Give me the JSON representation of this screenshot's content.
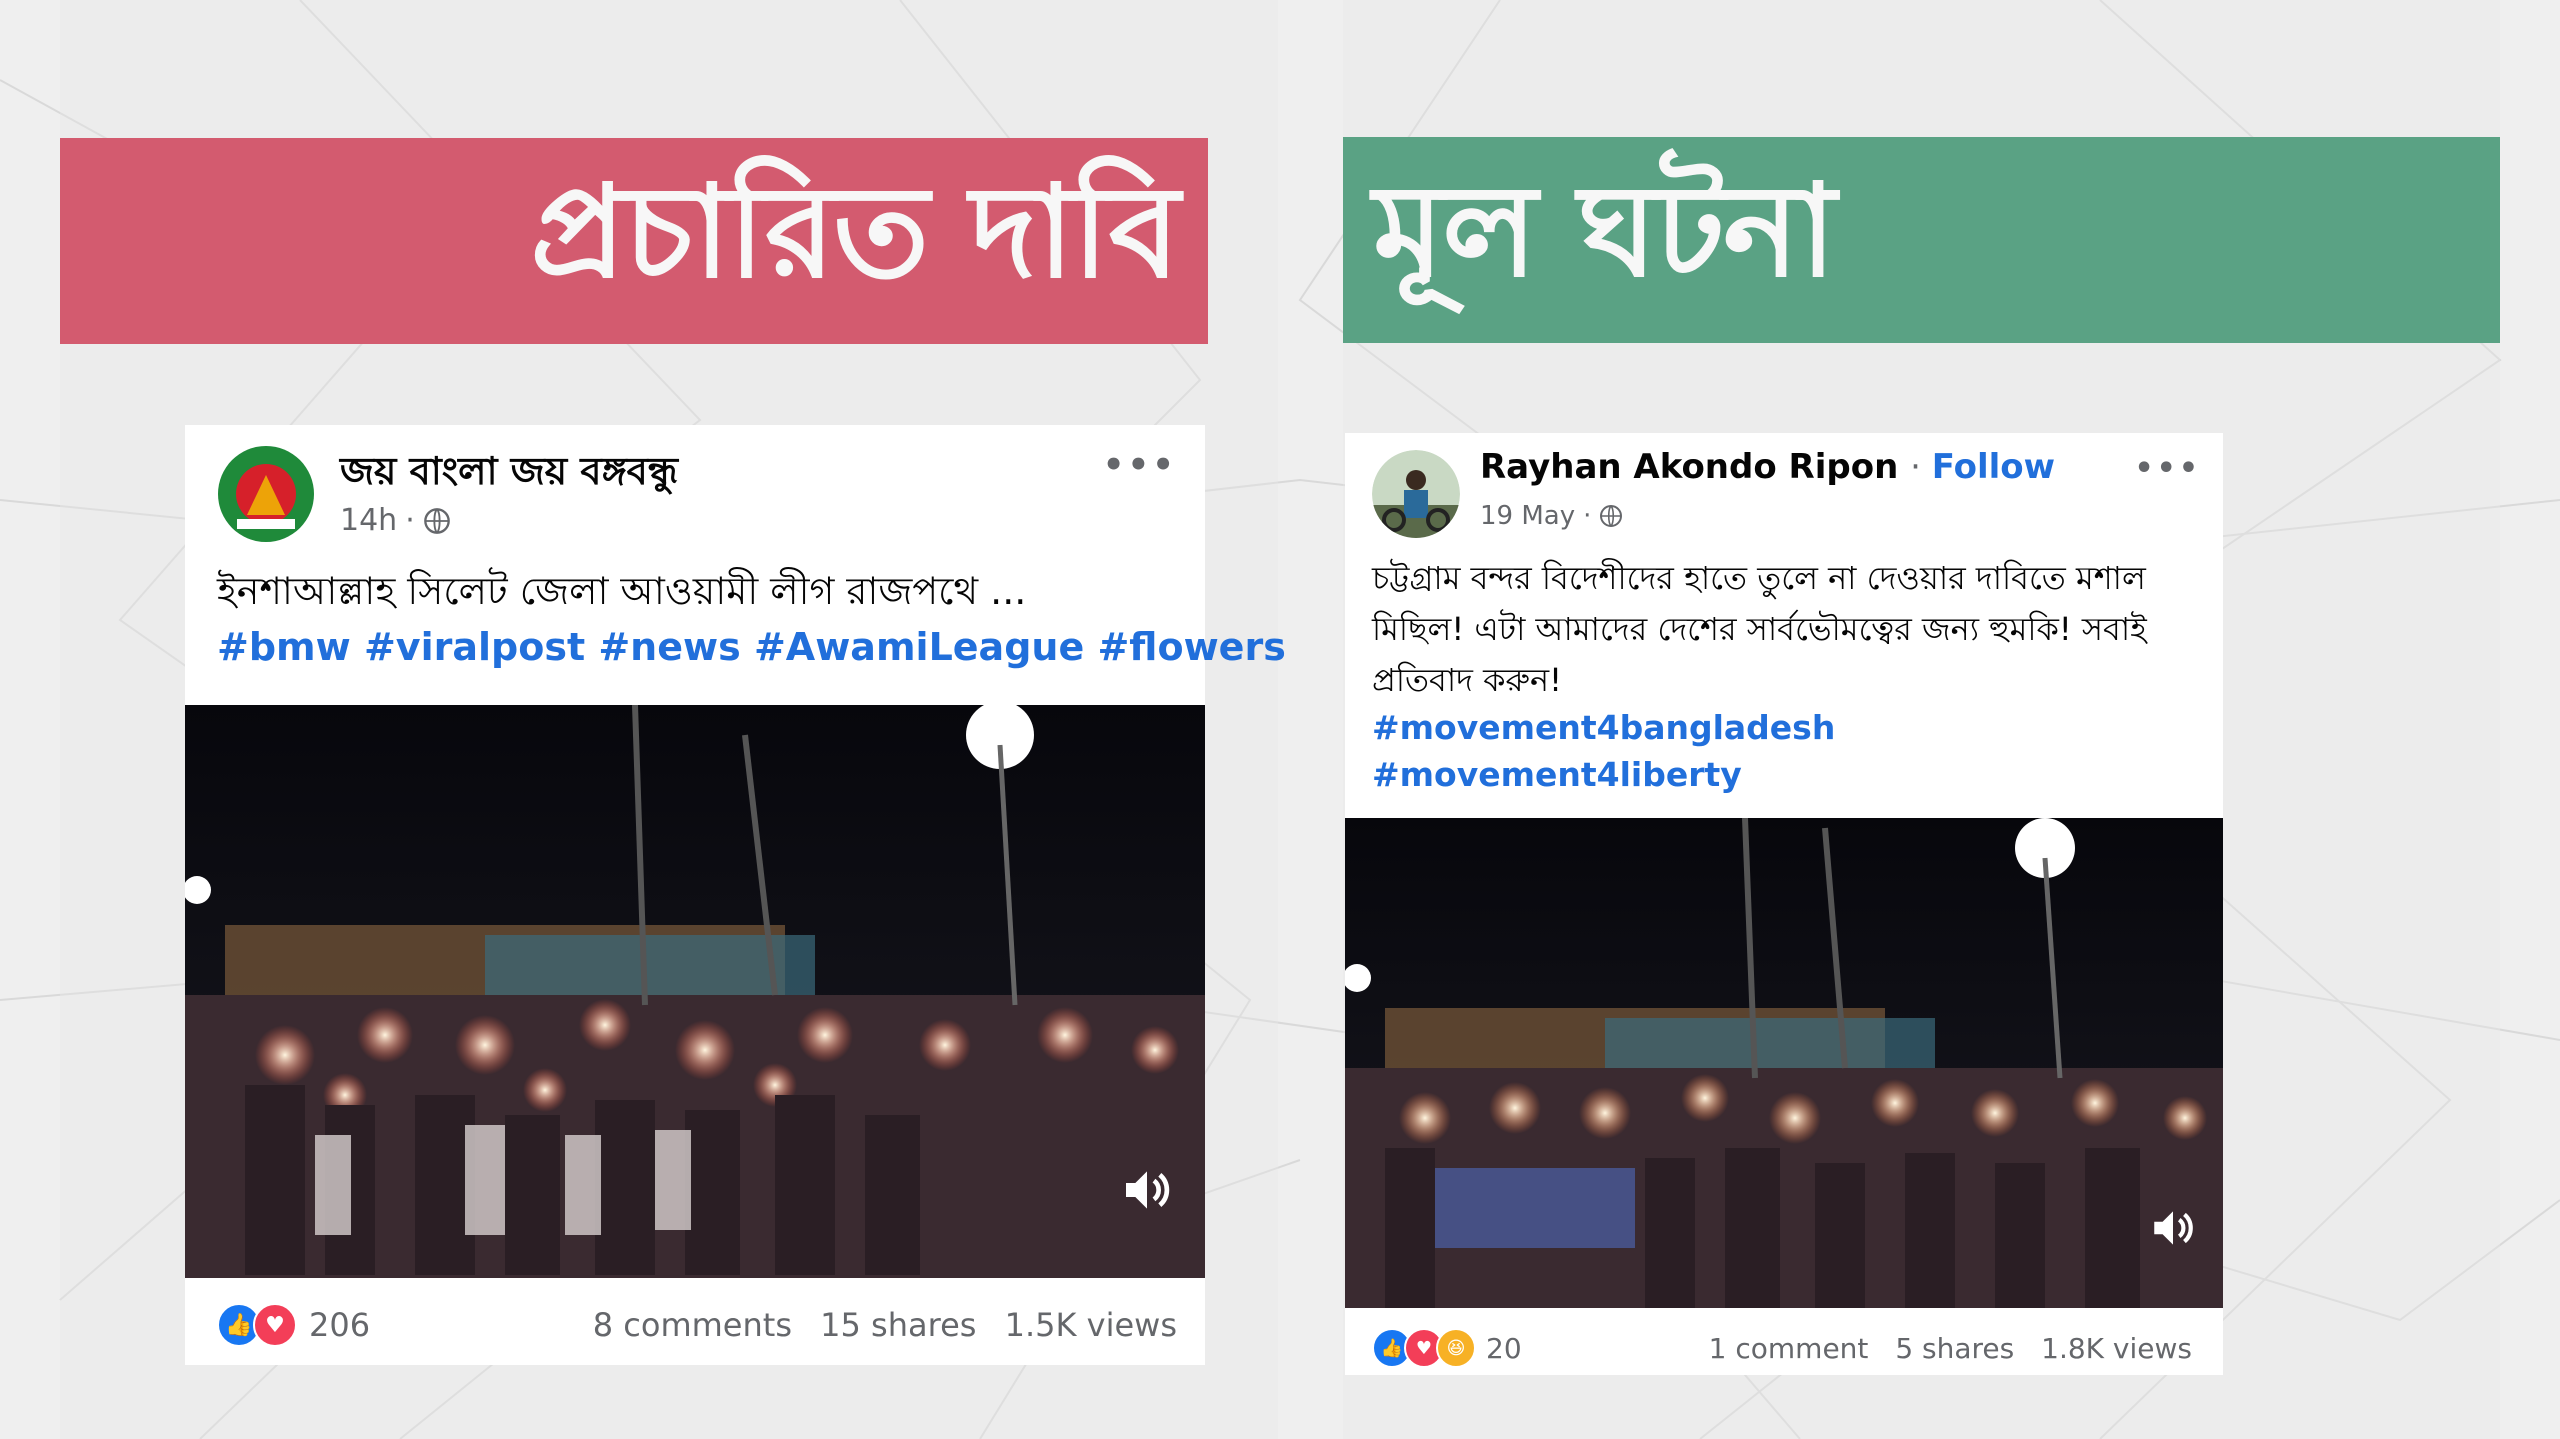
{
  "left": {
    "banner": "প্রচারিত দাবি",
    "post": {
      "author": "জয় বাংলা জয় বঙ্গবন্ধু",
      "time": "14h",
      "text": "ইনশাআল্লাহ সিলেট জেলা আওয়ামী লীগ রাজপথে ...",
      "tags": "#bmw #viralpost #news #AwamiLeague #flowers",
      "reactions_count": "206",
      "comments": "8 comments",
      "shares": "15 shares",
      "views": "1.5K views"
    }
  },
  "right": {
    "banner": "মূল ঘটনা",
    "post": {
      "author": "Rayhan Akondo Ripon",
      "follow": "Follow",
      "time": "19 May",
      "text": "চট্টগ্রাম বন্দর বিদেশীদের হাতে তুলে না দেওয়ার দাবিতে মশাল মিছিল! এটা আমাদের দেশের সার্বভৌমত্বের জন্য হুমকি! সবাই প্রতিবাদ করুন!",
      "tag1": "#movement4bangladesh",
      "tag2": "#movement4liberty",
      "reactions_count": "20",
      "comments": "1 comment",
      "shares": "5 shares",
      "views": "1.8K views"
    }
  },
  "icons": {
    "more": "more-options-icon",
    "privacy": "globe-icon",
    "sound": "speaker-icon",
    "like": "like-icon",
    "love": "love-icon",
    "haha": "haha-icon"
  },
  "colors": {
    "claim_red": "#c8102e",
    "fact_green": "#0f7d4f",
    "link_blue": "#216fdb"
  }
}
